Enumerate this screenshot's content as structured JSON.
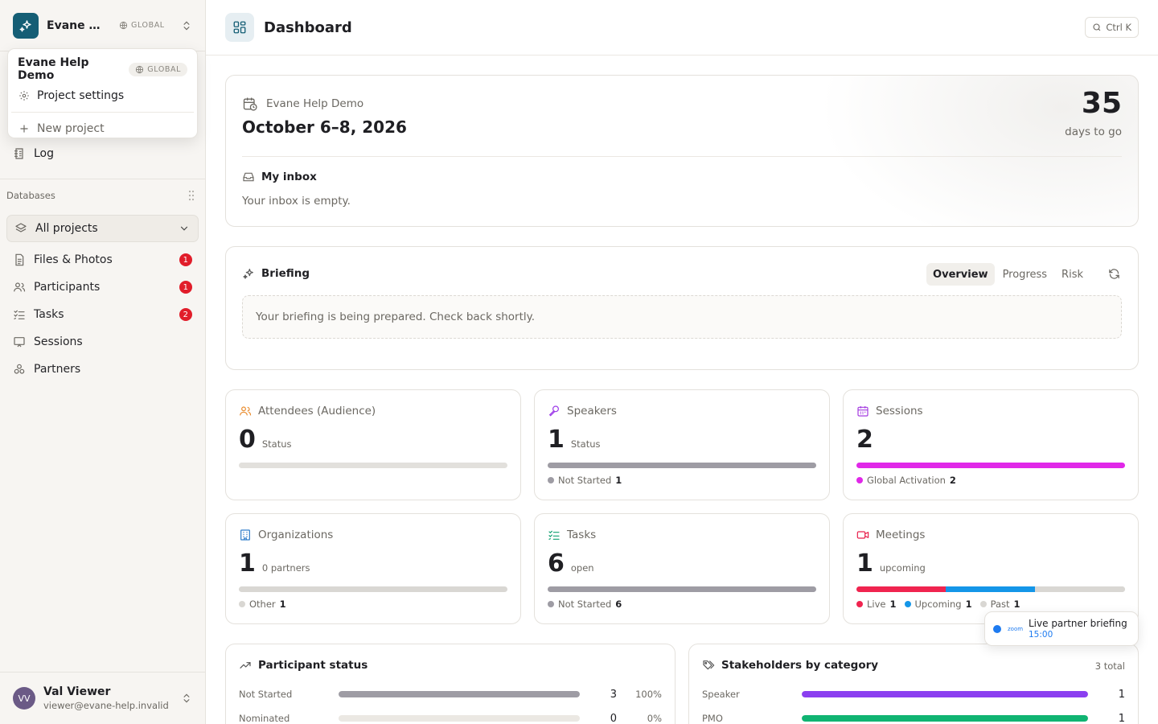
{
  "workspace": {
    "name": "Evane Help Demo",
    "short_name": "Evane He…",
    "scope": "GLOBAL",
    "brand_color": "#155e75"
  },
  "dropdown": {
    "project_name": "Evane Help Demo",
    "scope": "GLOBAL",
    "settings_label": "Project settings",
    "new_project_label": "New project"
  },
  "sidebar": {
    "log_label": "Log",
    "databases_label": "Databases",
    "project_selector": "All projects",
    "items": [
      {
        "label": "Files & Photos",
        "icon": "file-icon",
        "badge": "1"
      },
      {
        "label": "Participants",
        "icon": "users-icon",
        "badge": "1"
      },
      {
        "label": "Tasks",
        "icon": "checklist-icon",
        "badge": "2"
      },
      {
        "label": "Sessions",
        "icon": "presentation-icon",
        "badge": ""
      },
      {
        "label": "Partners",
        "icon": "partners-icon",
        "badge": ""
      }
    ]
  },
  "user": {
    "initials": "VV",
    "name": "Val Viewer",
    "email": "viewer@evane-help.invalid"
  },
  "header": {
    "title": "Dashboard",
    "shortcut": "Ctrl K"
  },
  "event": {
    "project": "Evane Help Demo",
    "dates": "October 6–8, 2026",
    "days": "35",
    "days_label": "days to go"
  },
  "inbox": {
    "title": "My inbox",
    "empty": "Your inbox is empty."
  },
  "briefing": {
    "title": "Briefing",
    "tabs": [
      "Overview",
      "Progress",
      "Risk"
    ],
    "active_tab": "Overview",
    "message": "Your briefing is being prepared. Check back shortly."
  },
  "stats": {
    "attendees": {
      "title": "Attendees (Audience)",
      "value": "0",
      "unit": "Status"
    },
    "speakers": {
      "title": "Speakers",
      "value": "1",
      "unit": "Status",
      "legend": [
        {
          "label": "Not Started",
          "count": "1",
          "color": "#9e9ca4"
        }
      ]
    },
    "sessions": {
      "title": "Sessions",
      "value": "2",
      "unit": "",
      "legend": [
        {
          "label": "Global Activation",
          "count": "2",
          "color": "#e028e8"
        }
      ]
    },
    "organizations": {
      "title": "Organizations",
      "value": "1",
      "unit": "0 partners",
      "legend": [
        {
          "label": "Other",
          "count": "1",
          "color": "#d9d7d3"
        }
      ]
    },
    "tasks": {
      "title": "Tasks",
      "value": "6",
      "unit": "open",
      "legend": [
        {
          "label": "Not Started",
          "count": "6",
          "color": "#9e9ca4"
        }
      ]
    },
    "meetings": {
      "title": "Meetings",
      "value": "1",
      "unit": "upcoming",
      "legend": [
        {
          "label": "Live",
          "count": "1",
          "color": "#f0244f"
        },
        {
          "label": "Upcoming",
          "count": "1",
          "color": "#1496e8"
        },
        {
          "label": "Past",
          "count": "1",
          "color": "#d9d7d3"
        }
      ]
    }
  },
  "toast": {
    "title": "Live partner briefing",
    "time": "15:00",
    "brand": "zoom"
  },
  "participant_status": {
    "title": "Participant status",
    "rows": [
      {
        "label": "Not Started",
        "value": "3",
        "pct": "100%",
        "fill": 1.0,
        "color": "#9e9ca4"
      },
      {
        "label": "Nominated",
        "value": "0",
        "pct": "0%",
        "fill": 0.0,
        "color": "#9e9ca4"
      }
    ]
  },
  "stakeholders": {
    "title": "Stakeholders by category",
    "total": "3 total",
    "rows": [
      {
        "label": "Speaker",
        "value": "1",
        "fill": 1.0,
        "color": "#8b3ff0"
      },
      {
        "label": "PMO",
        "value": "1",
        "fill": 1.0,
        "color": "#10b472"
      }
    ]
  }
}
